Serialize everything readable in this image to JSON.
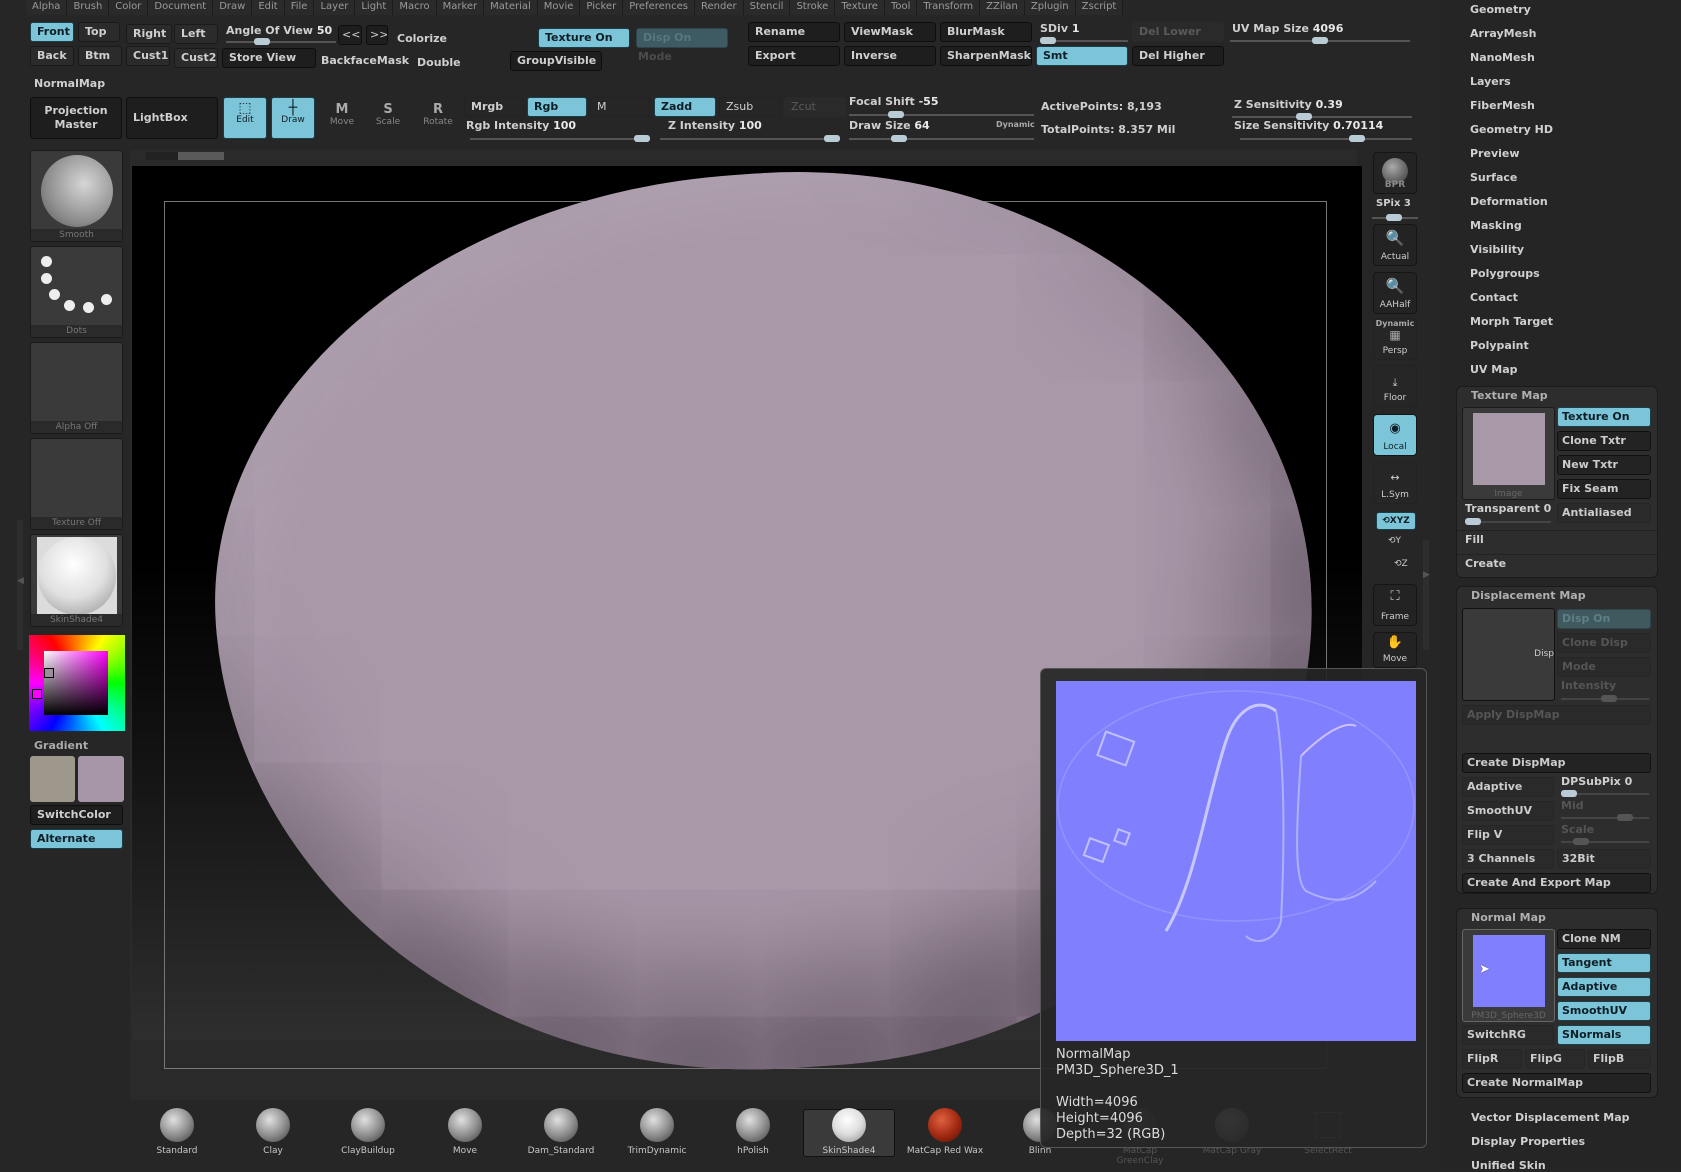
{
  "menu": [
    "Alpha",
    "Brush",
    "Color",
    "Document",
    "Draw",
    "Edit",
    "File",
    "Layer",
    "Light",
    "Macro",
    "Marker",
    "Material",
    "Movie",
    "Picker",
    "Preferences",
    "Render",
    "Stencil",
    "Stroke",
    "Texture",
    "Tool",
    "Transform",
    "ZZilan",
    "Zplugin",
    "Zscript"
  ],
  "views": {
    "front": "Front",
    "top": "Top",
    "right": "Right",
    "left": "Left",
    "back": "Back",
    "btm": "Btm",
    "cust1": "Cust1",
    "cust2": "Cust2"
  },
  "angle_of_view": {
    "label": "Angle Of View",
    "value": "50",
    "level": 0.3
  },
  "nav": {
    "prev": "<<",
    "next": ">>"
  },
  "colorize": "Colorize",
  "store_view": "Store View",
  "backface_mask": "BackfaceMask",
  "double": "Double",
  "texture_on": "Texture On",
  "disp_on": "Disp On",
  "mode": "Mode",
  "group_visible": "GroupVisible",
  "top_right_buttons": {
    "rename": "Rename",
    "export": "Export",
    "viewmask": "ViewMask",
    "inverse": "Inverse",
    "blurmask": "BlurMask",
    "sharpenmask": "SharpenMask",
    "smt": "Smt",
    "del_lower": "Del Lower",
    "del_higher": "Del Higher"
  },
  "sdiv": {
    "label": "SDiv",
    "value": "1",
    "level": 0.0
  },
  "uv_map_size": {
    "label": "UV Map Size",
    "value": "4096",
    "level": 0.5
  },
  "tool_title": "NormalMap",
  "projection_master": "Projection Master",
  "lightbox": "LightBox",
  "modes": {
    "edit": "Edit",
    "draw": "Draw",
    "move": "Move",
    "scale": "Scale",
    "rotate": "Rotate"
  },
  "mrgb": "Mrgb",
  "rgb": "Rgb",
  "m": "M",
  "rgb_intensity": {
    "label": "Rgb Intensity",
    "value": "100",
    "level": 1.0
  },
  "zadd": "Zadd",
  "zsub": "Zsub",
  "zcut": "Zcut",
  "z_intensity": {
    "label": "Z Intensity",
    "value": "100",
    "level": 1.0
  },
  "focal_shift": {
    "label": "Focal Shift",
    "value": "-55",
    "level": 0.23
  },
  "draw_size": {
    "label": "Draw Size",
    "value": "64",
    "level": 0.25
  },
  "dynamic": "Dynamic",
  "active_points": "ActivePoints: 8,193",
  "total_points": "TotalPoints: 8.357 Mil",
  "z_sensitivity": {
    "label": "Z Sensitivity",
    "value": "0.39",
    "level": 0.39
  },
  "size_sensitivity": {
    "label": "Size Sensitivity",
    "value": "0.70114",
    "level": 0.7
  },
  "left_tiles": {
    "brush": "Smooth",
    "stroke": "Dots",
    "alpha": "Alpha Off",
    "texture": "Texture Off",
    "material": "SkinShade4"
  },
  "gradient": "Gradient",
  "switch_color": "SwitchColor",
  "alternate": "Alternate",
  "colors": {
    "accent": "#7cc4d8",
    "main_color": "#9e978c",
    "secondary_color": "#a696a8",
    "mesh": "#a898a8",
    "normal_map": "#8080ff"
  },
  "right_tools": {
    "bpr": "BPR",
    "spix": "SPix 3",
    "actual": "Actual",
    "aahalf": "AAHalf",
    "dynamic": "Dynamic",
    "persp": "Persp",
    "floor": "Floor",
    "local": "Local",
    "lsym": "L.Sym",
    "xyz": "XYZ",
    "y": "Y",
    "z": "Z",
    "frame": "Frame",
    "move": "Move"
  },
  "tool_menu": [
    "Geometry",
    "ArrayMesh",
    "NanoMesh",
    "Layers",
    "FiberMesh",
    "Geometry HD",
    "Preview",
    "Surface",
    "Deformation",
    "Masking",
    "Visibility",
    "Polygroups",
    "Contact",
    "Morph Target",
    "Polypaint",
    "UV Map"
  ],
  "texture_map": {
    "title": "Texture Map",
    "image": "Image",
    "texture_on": "Texture On",
    "clone": "Clone Txtr",
    "new": "New Txtr",
    "fix_seam": "Fix Seam",
    "transparent": "Transparent 0",
    "antialiased": "Antialiased",
    "fill": "Fill",
    "create": "Create"
  },
  "displacement_map": {
    "title": "Displacement Map",
    "disp": "Disp",
    "disp_on": "Disp On",
    "clone": "Clone Disp",
    "mode": "Mode",
    "intensity": "Intensity",
    "apply": "Apply DispMap",
    "create": "Create DispMap",
    "adaptive": "Adaptive",
    "dpsubpix": "DPSubPix 0",
    "smoothuv": "SmoothUV",
    "mid": "Mid",
    "flipv": "Flip V",
    "scale": "Scale",
    "channels": "3 Channels",
    "bit": "32Bit",
    "export": "Create And Export Map"
  },
  "normal_map": {
    "title": "Normal Map",
    "thumb_caption": "PM3D_Sphere3D",
    "clone": "Clone NM",
    "tangent": "Tangent",
    "adaptive": "Adaptive",
    "smoothuv": "SmoothUV",
    "switchrg": "SwitchRG",
    "snormals": "SNormals",
    "flipr": "FlipR",
    "flipg": "FlipG",
    "flipb": "FlipB",
    "create": "Create NormalMap"
  },
  "bottom_menu": [
    "Vector Displacement Map",
    "Display Properties",
    "Unified Skin"
  ],
  "tooltip": {
    "line1": "NormalMap",
    "line2": "PM3D_Sphere3D_1",
    "line3": "Width=4096",
    "line4": "Height=4096",
    "line5": "Depth=32 (RGB)"
  },
  "shelf": [
    "Standard",
    "Clay",
    "ClayBuildup",
    "Move",
    "Dam_Standard",
    "TrimDynamic",
    "hPolish",
    "SkinShade4",
    "MatCap Red Wax",
    "Blinn",
    "MatCap GreenClay",
    "MatCap Gray",
    "SelectRect"
  ]
}
